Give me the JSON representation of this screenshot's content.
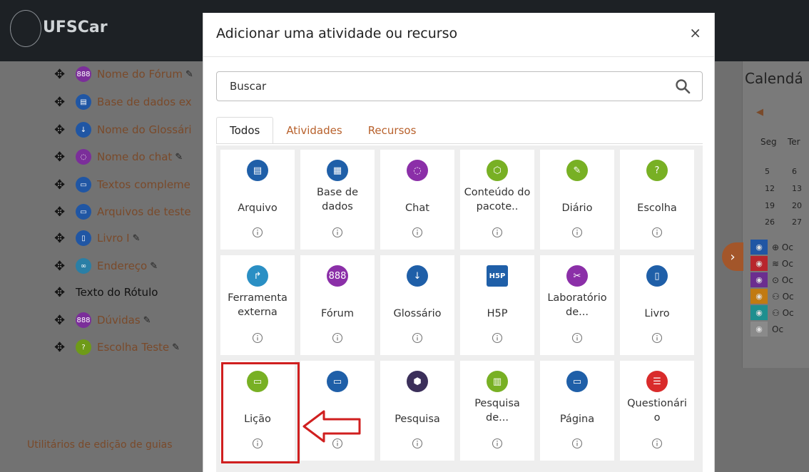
{
  "brand": {
    "name": "UFSCar"
  },
  "course_items": [
    {
      "label": "Nome do Fórum",
      "color": "#7b2e9a",
      "glyph": "888",
      "pen": true
    },
    {
      "label": "Base de dados ex",
      "color": "#2056a4",
      "glyph": "▤",
      "pen": false
    },
    {
      "label": "Nome do Glossári",
      "color": "#2056a4",
      "glyph": "↓",
      "pen": false
    },
    {
      "label": "Nome do chat",
      "color": "#7b2e9a",
      "glyph": "◌",
      "pen": true
    },
    {
      "label": "Textos compleme",
      "color": "#2056a4",
      "glyph": "▭",
      "pen": false
    },
    {
      "label": "Arquivos de teste",
      "color": "#2056a4",
      "glyph": "▭",
      "pen": false
    },
    {
      "label": "Livro I",
      "color": "#2056a4",
      "glyph": "▯",
      "pen": true
    },
    {
      "label": "Endereço",
      "color": "#2a7fa6",
      "glyph": "∞",
      "pen": true
    },
    {
      "label": "Texto do Rótulo",
      "color": "",
      "glyph": "",
      "pen": false
    },
    {
      "label": "Dúvidas",
      "color": "#7b2e9a",
      "glyph": "888",
      "pen": true
    },
    {
      "label": "Escolha Teste",
      "color": "#6e9a18",
      "glyph": "?",
      "pen": true
    }
  ],
  "utilities_label": "Utilitários de edição de guias",
  "calendar": {
    "title": "Calendá",
    "days": [
      "Seg",
      "Ter"
    ],
    "rows": [
      [
        "5",
        "6"
      ],
      [
        "12",
        "13"
      ],
      [
        "19",
        "20"
      ],
      [
        "26",
        "27"
      ]
    ],
    "events": [
      {
        "color": "#2056a4",
        "label": "⊕ Oc"
      },
      {
        "color": "#b8262d",
        "label": "≋ Oc"
      },
      {
        "color": "#6b2e8f",
        "label": "⊙ Oc"
      },
      {
        "color": "#c17a12",
        "label": "⚇ Oc"
      },
      {
        "color": "#1e8f8f",
        "label": "⚇ Oc"
      },
      {
        "color": "#8a8a8a",
        "label": "Oc"
      }
    ]
  },
  "modal": {
    "title": "Adicionar uma atividade ou recurso",
    "close_label": "×",
    "search_placeholder": "Buscar",
    "tabs": [
      "Todos",
      "Atividades",
      "Recursos"
    ],
    "items": [
      {
        "name": "Arquivo",
        "color": "#1f5fa8",
        "glyph": "▤"
      },
      {
        "name": "Base de dados",
        "color": "#1f5fa8",
        "glyph": "▦"
      },
      {
        "name": "Chat",
        "color": "#8b2fa8",
        "glyph": "◌"
      },
      {
        "name": "Conteúdo do pacote..",
        "color": "#78b024",
        "glyph": "⬡"
      },
      {
        "name": "Diário",
        "color": "#78b024",
        "glyph": "✎"
      },
      {
        "name": "Escolha",
        "color": "#78b024",
        "glyph": "?"
      },
      {
        "name": "Ferramenta externa",
        "color": "#2a8fc4",
        "glyph": "↱"
      },
      {
        "name": "Fórum",
        "color": "#8b2fa8",
        "glyph": "888"
      },
      {
        "name": "Glossário",
        "color": "#1f5fa8",
        "glyph": "↓"
      },
      {
        "name": "H5P",
        "color": "#1f5fa8",
        "glyph": "H5P"
      },
      {
        "name": "Laboratório de...",
        "color": "#8b2fa8",
        "glyph": "✂"
      },
      {
        "name": "Livro",
        "color": "#1f5fa8",
        "glyph": "▯"
      },
      {
        "name": "Lição",
        "color": "#78b024",
        "glyph": "▭"
      },
      {
        "name": "",
        "color": "#1f5fa8",
        "glyph": "▭"
      },
      {
        "name": "Pesquisa",
        "color": "#3b2f5a",
        "glyph": "⬢"
      },
      {
        "name": "Pesquisa de...",
        "color": "#78b024",
        "glyph": "▥"
      },
      {
        "name": "Página",
        "color": "#1f5fa8",
        "glyph": "▭"
      },
      {
        "name": "Questionári o",
        "color": "#d92b2b",
        "glyph": "☰"
      }
    ]
  },
  "annotation_color": "#d01f1f"
}
